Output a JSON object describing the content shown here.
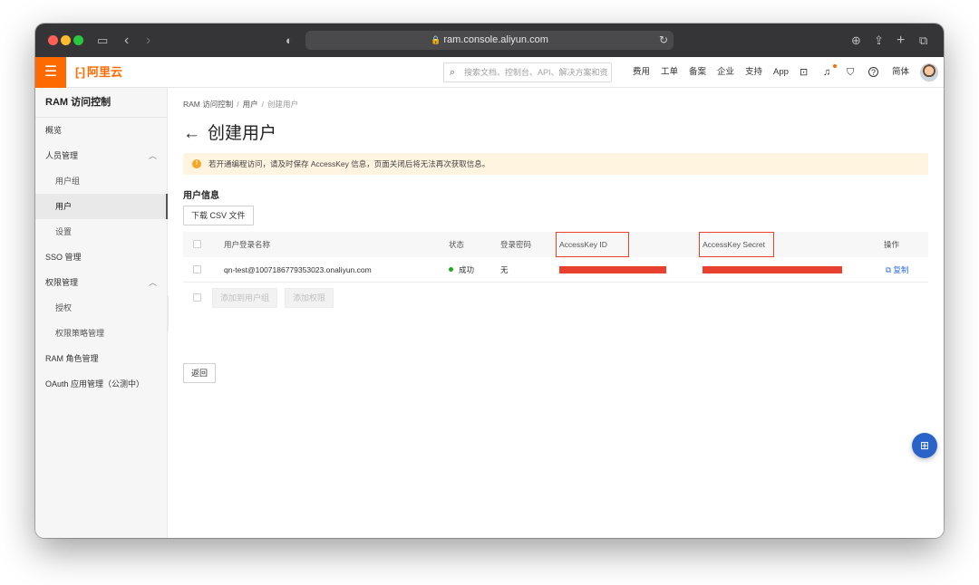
{
  "browser": {
    "url": "ram.console.aliyun.com",
    "lock_glyph": "🔒",
    "icons": {
      "sidebar": "▭",
      "back": "‹",
      "forward": "›",
      "privacy": "◐",
      "reload": "↻",
      "download": "⊕",
      "share": "⇪",
      "new_tab": "+",
      "tabs": "⧉"
    }
  },
  "header": {
    "menu_glyph": "☰",
    "logo_bracket": "[-]",
    "logo_text": "阿里云",
    "search_placeholder": "搜索文档、控制台、API、解决方案和资",
    "search_glyph": "⌕",
    "nav": [
      "费用",
      "工单",
      "备案",
      "企业",
      "支持",
      "App"
    ],
    "icons": {
      "terminal": "⊡",
      "bell": "♫",
      "cart": "⛉",
      "help": "?"
    },
    "language": "简体"
  },
  "sidebar": {
    "title": "RAM 访问控制",
    "items": [
      {
        "label": "概览"
      },
      {
        "label": "人员管理",
        "chevron": "︿"
      },
      {
        "label": "用户组"
      },
      {
        "label": "用户"
      },
      {
        "label": "设置"
      },
      {
        "label": "SSO 管理"
      },
      {
        "label": "权限管理",
        "chevron": "︿"
      },
      {
        "label": "授权"
      },
      {
        "label": "权限策略管理"
      },
      {
        "label": "RAM 角色管理"
      },
      {
        "label": "OAuth 应用管理（公测中）"
      }
    ],
    "collapse_glyph": "‹"
  },
  "main": {
    "breadcrumb": [
      "RAM 访问控制",
      "用户",
      "创建用户"
    ],
    "breadcrumb_sep": "/",
    "title_arrow": "←",
    "title": "创建用户",
    "alert_icon": "!",
    "alert_text": "若开通编程访问，请及时保存 AccessKey 信息，页面关闭后将无法再次获取信息。",
    "section_title": "用户信息",
    "download_button": "下载 CSV 文件",
    "table": {
      "headers": {
        "login_name": "用户登录名称",
        "status": "状态",
        "password": "登录密码",
        "access_key_id": "AccessKey ID",
        "access_key_secret": "AccessKey Secret",
        "actions": "操作"
      },
      "row": {
        "login_name": "qn-test@1007186779353023.onaliyun.com",
        "status": "成功",
        "password": "无",
        "copy_icon": "⧉",
        "copy_label": "复制"
      },
      "add_to_group_button": "添加到用户组",
      "add_permission_button": "添加权限"
    },
    "back_button": "返回"
  },
  "fab_glyph": "⊞",
  "colors": {
    "brand_orange": "#ff6a00",
    "redact_red": "#e8412f",
    "link_blue": "#2b6de0",
    "success_green": "#1aad19",
    "fab_blue": "#2a64c9"
  }
}
